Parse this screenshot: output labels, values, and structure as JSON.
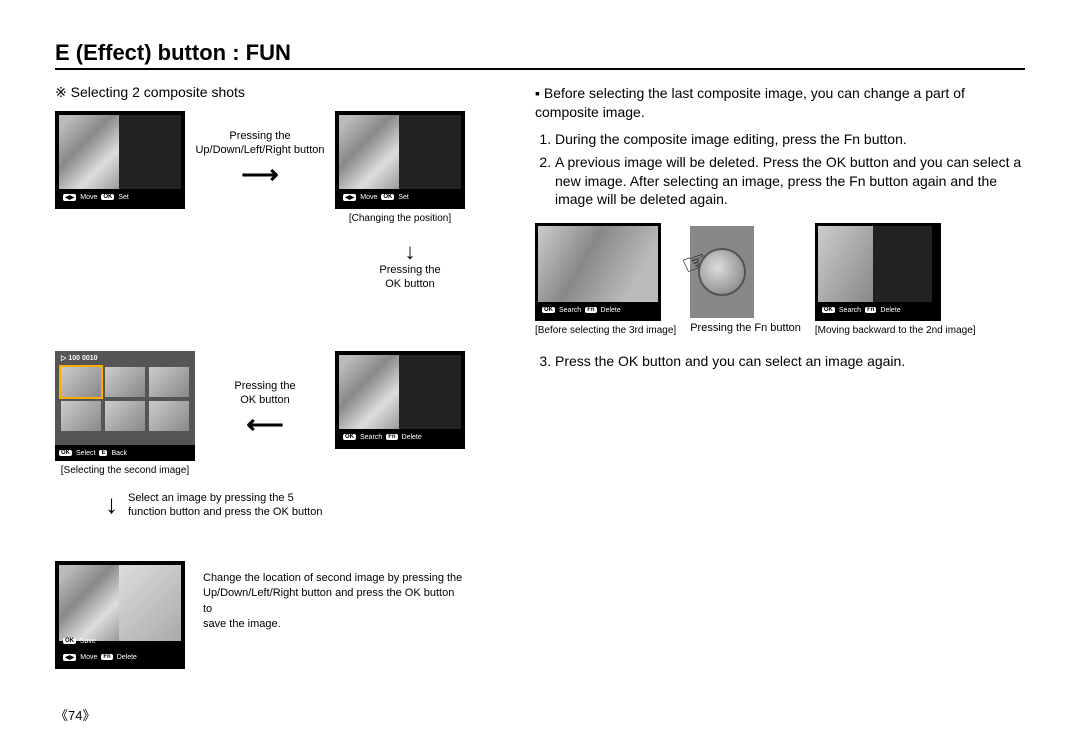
{
  "page_title": "E (Effect) button : FUN",
  "page_number": "《74》",
  "left": {
    "heading": "※ Selecting 2 composite shots",
    "row1": {
      "screen1_bar": {
        "pill1": "◀▶",
        "l1": "Move",
        "pill2": "OK",
        "l2": "Set"
      },
      "mid_text_1": "Pressing the",
      "mid_text_2": "Up/Down/Left/Right button",
      "screen2_bar": {
        "pill1": "◀▶",
        "l1": "Move",
        "pill2": "OK",
        "l2": "Set"
      },
      "caption2": "[Changing the position]"
    },
    "down1_a": "Pressing the",
    "down1_b": "OK button",
    "row2_mid_a": "Pressing the",
    "row2_mid_b": "OK button",
    "thumb_top": "▷ 100 0010",
    "thumb_bar": {
      "pill1": "OK",
      "l1": "Select",
      "pill2": "E",
      "l2": "Back"
    },
    "thumb_caption": "[Selecting the second image]",
    "screen3_bar": {
      "pill1": "OK",
      "l1": "Search",
      "pill2": "Fn",
      "l2": "Delete"
    },
    "down2_a": "Select an image by pressing the 5",
    "down2_b": "function button and press the OK button",
    "final_caption_line": "",
    "row3_bar_top": "OK Save",
    "row3_bar": {
      "pill1": "◀▶",
      "l1": "Move",
      "pill2": "Fn",
      "l2": "Delete"
    },
    "row3_text_1": "Change the location of second image by pressing the",
    "row3_text_2": "Up/Down/Left/Right button and press the OK button to",
    "row3_text_3": "save the image."
  },
  "right": {
    "intro_bullet": "▪ Before selecting the last composite image, you can change a part of composite image.",
    "step1": "During the composite image editing, press the Fn button.",
    "step2": "A previous image will be deleted. Press the OK button and you can select a new image. After selecting an image, press the Fn button again and the image will be deleted again.",
    "mini1_bar": {
      "pill1": "OK",
      "l1": "Search",
      "pill2": "Fn",
      "l2": "Delete"
    },
    "mini1_caption": "[Before selecting the 3rd image]",
    "mid_label": "Pressing the Fn button",
    "mini2_bar": {
      "pill1": "OK",
      "l1": "Search",
      "pill2": "Fn",
      "l2": "Delete"
    },
    "mini2_caption": "[Moving backward to the 2nd image]",
    "step3": "Press the OK button and you can select an image again."
  }
}
